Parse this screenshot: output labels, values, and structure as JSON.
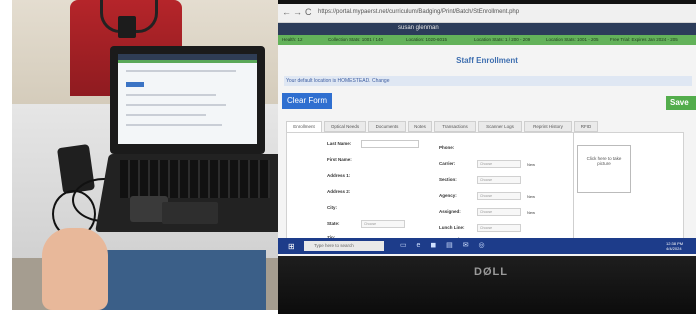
{
  "browser": {
    "nav_back": "←",
    "nav_forward": "→",
    "nav_reload": "C",
    "url": "https://portal.mypaerst.net/curriculum/Badging/Print/Batch/StEnrollment.php"
  },
  "app": {
    "user_name": "susan glenman"
  },
  "status_bar": {
    "items": [
      "Health: 12",
      "Collection Stats: 1001 / 140",
      "Location: 1020-6015",
      "Location Stats: 1 / 200 - 209",
      "Location Stats: 1001 - 205",
      "Free Trial: Expires Jan 2024 - 205"
    ]
  },
  "page": {
    "title": "Staff Enrollment",
    "location_notice": "Your default location is HOMESTEAD. Change",
    "clear_form": "Clear Form",
    "save": "Save"
  },
  "tabs": [
    "Enrollment",
    "Optical Needs",
    "Documents",
    "Notes",
    "Transactions",
    "Scanner Logs",
    "Reprint History",
    "RFID"
  ],
  "form": {
    "left_fields": [
      "Last Name:",
      "First Name:",
      "Address 1:",
      "Address 2:",
      "City:",
      "State:",
      "Zip:"
    ],
    "state_placeholder": "Choose",
    "right_fields": [
      "Phone:",
      "Carrier:",
      "Section:",
      "Agency:",
      "Assigned:",
      "Lunch Line:",
      "Water Ind:"
    ],
    "select_placeholder": "Choose",
    "new_label": "New",
    "photo_prompt": "Click here to take picture"
  },
  "taskbar": {
    "start_glyph": "⊞",
    "search_placeholder": "Type here to search",
    "icons": "▭ e ◼ ▤ ✉ ◎",
    "time": "12:38 PM",
    "date": "4/4/2024"
  },
  "monitor": {
    "brand": "DØLL"
  }
}
